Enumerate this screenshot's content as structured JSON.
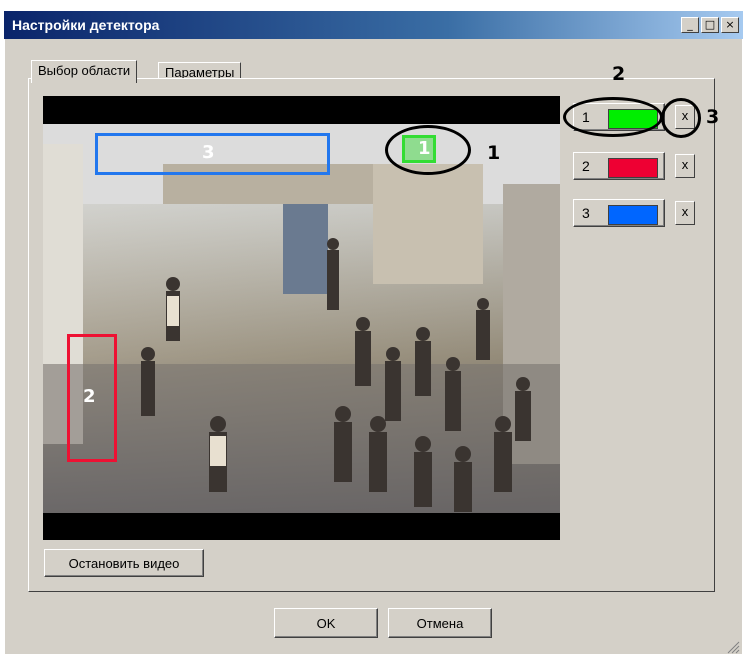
{
  "window": {
    "title": "Настройки детектора",
    "minimize_glyph": "_",
    "maximize_glyph": "□",
    "close_glyph": "×"
  },
  "tabs": [
    {
      "label": "Выбор области",
      "active": true
    },
    {
      "label": "Параметры",
      "active": false
    }
  ],
  "video": {
    "regions": [
      {
        "label": "1",
        "color": "#33dd33"
      },
      {
        "label": "2",
        "color": "#ee1133"
      },
      {
        "label": "3",
        "color": "#2277ee"
      }
    ]
  },
  "zones": [
    {
      "number": "1",
      "color": "#00ee00",
      "delete_label": "x"
    },
    {
      "number": "2",
      "color": "#ee0033",
      "delete_label": "x"
    },
    {
      "number": "3",
      "color": "#0066ff",
      "delete_label": "x"
    }
  ],
  "buttons": {
    "stop_video": "Остановить видео",
    "ok": "OK",
    "cancel": "Отмена"
  },
  "callouts": [
    "1",
    "2",
    "3"
  ]
}
